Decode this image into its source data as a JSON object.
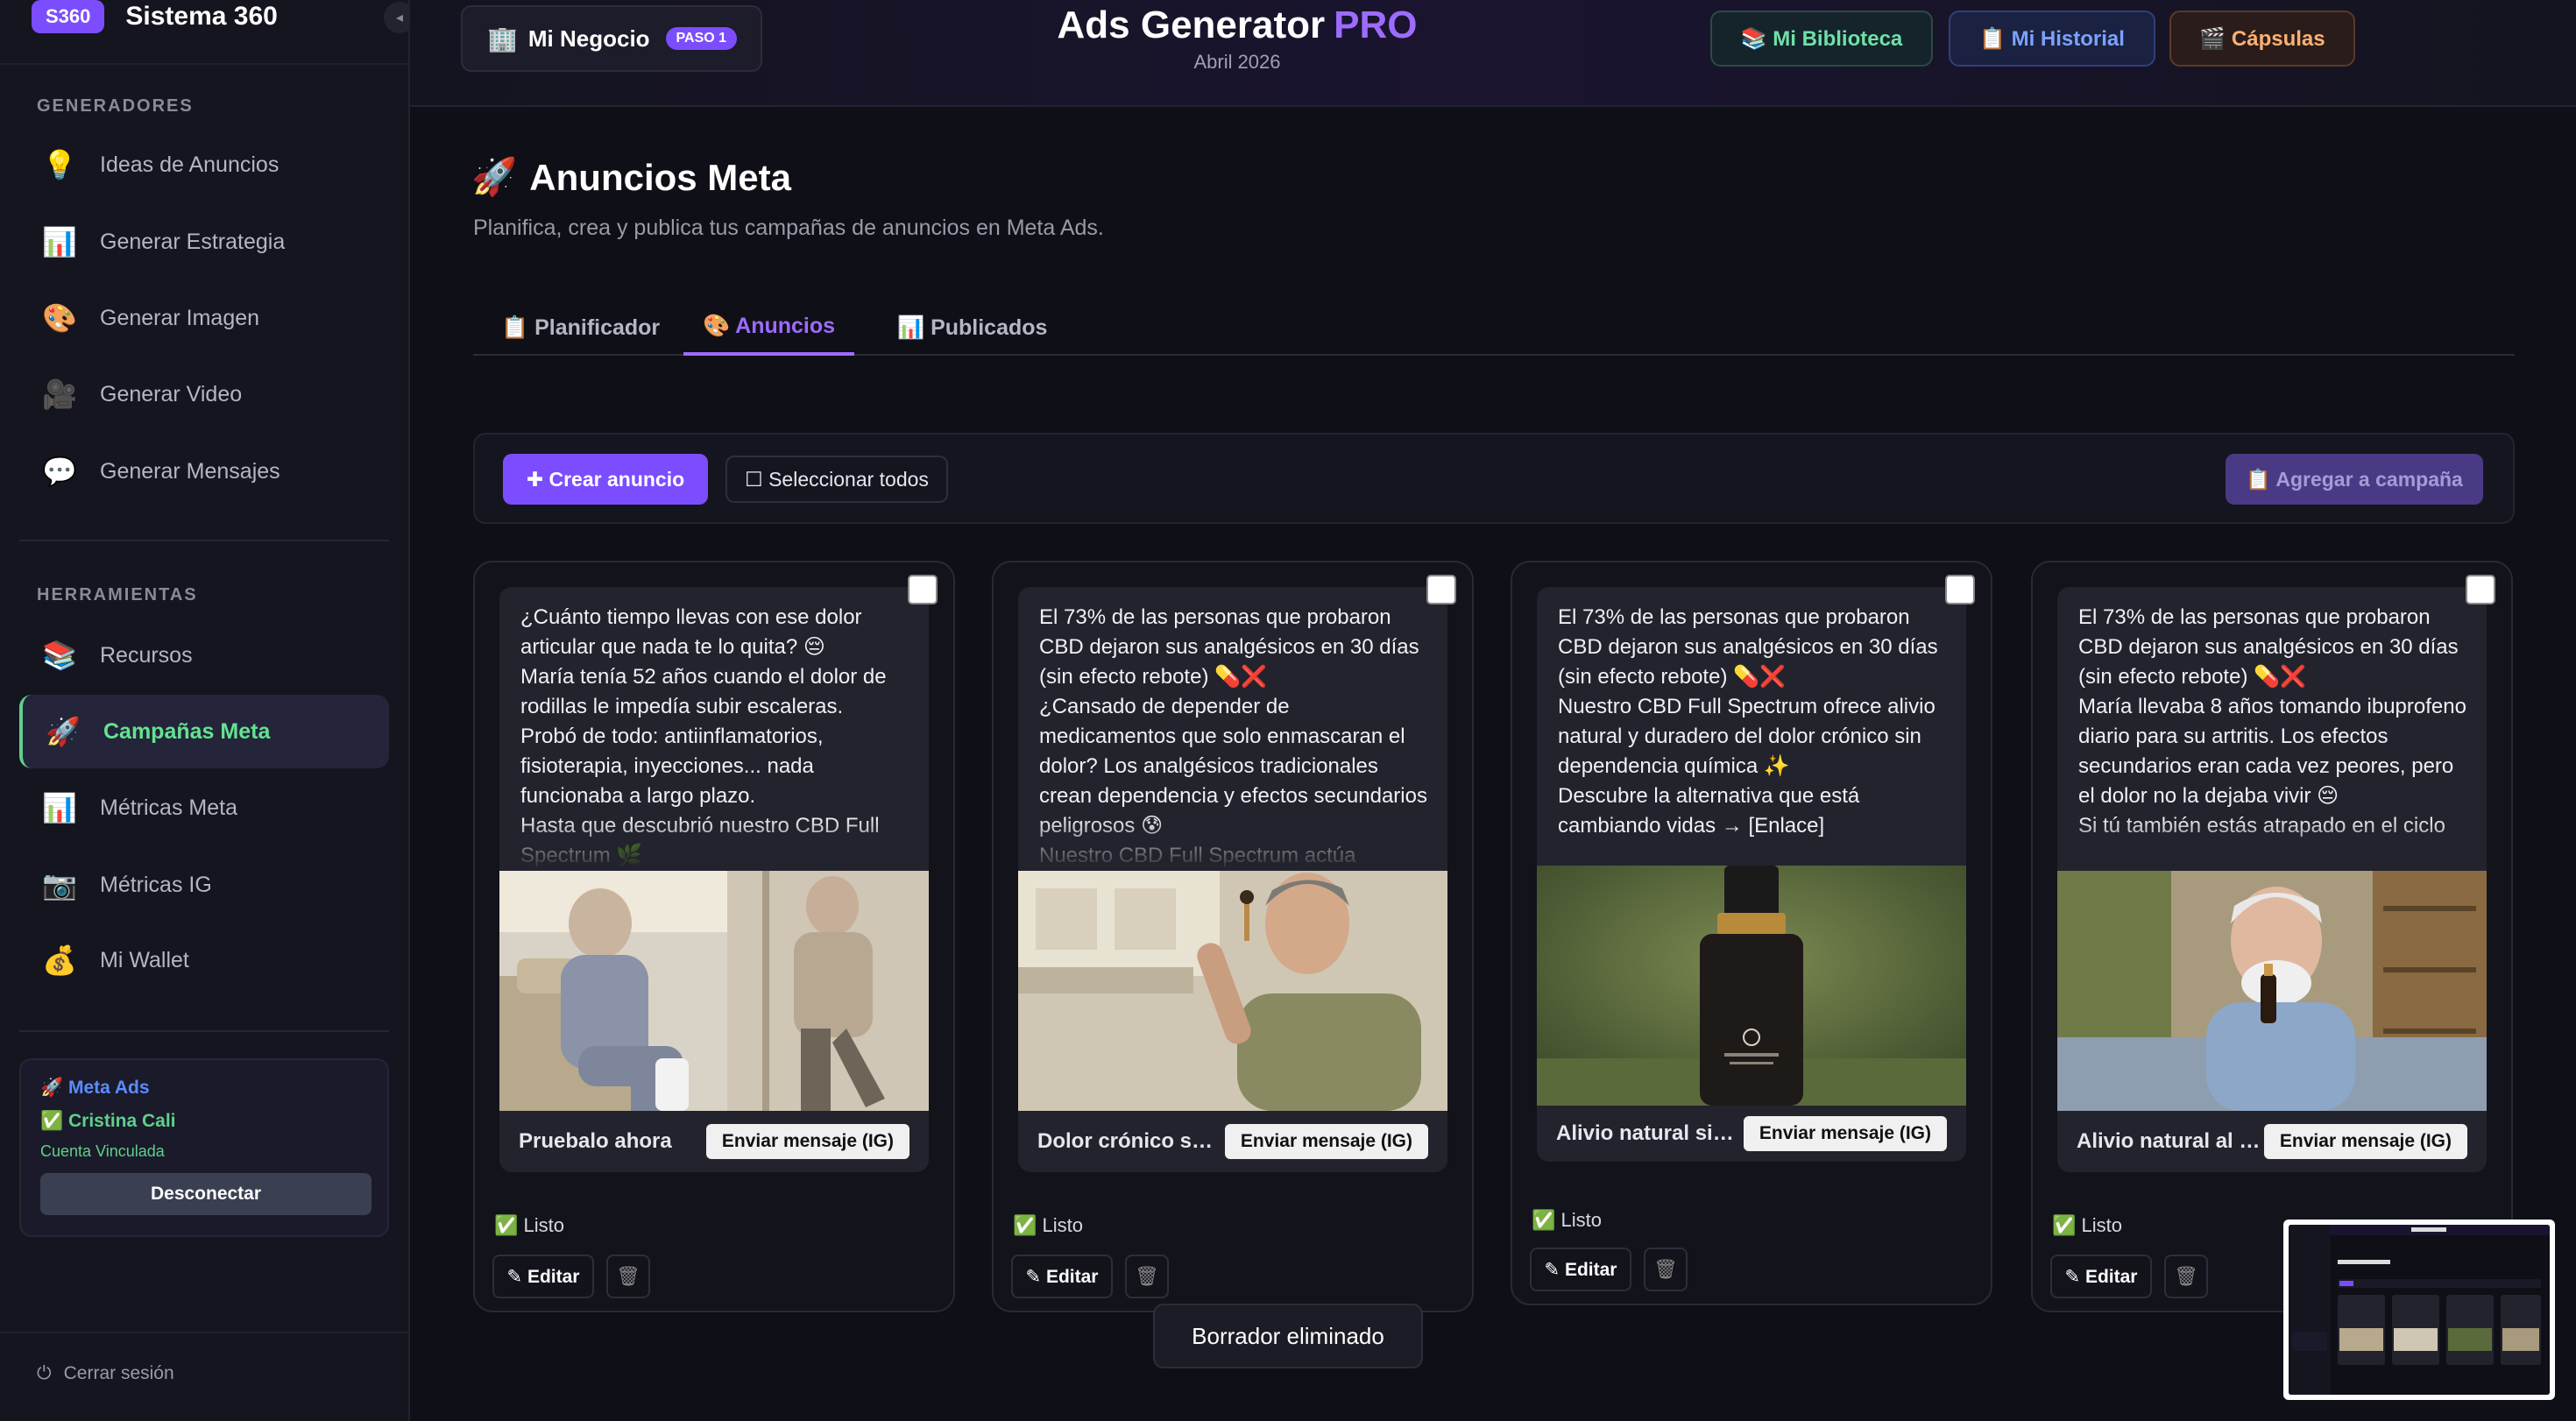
{
  "sidebar": {
    "badge": "S360",
    "brand": "Sistema 360",
    "collapse_icon": "◂",
    "sections": [
      {
        "title": "GENERADORES"
      },
      {
        "title": "HERRAMIENTAS"
      }
    ],
    "generadores": [
      {
        "icon": "💡",
        "label": "Ideas de Anuncios"
      },
      {
        "icon": "📊",
        "label": "Generar Estrategia"
      },
      {
        "icon": "🎨",
        "label": "Generar Imagen"
      },
      {
        "icon": "🎥",
        "label": "Generar Video"
      },
      {
        "icon": "💬",
        "label": "Generar Mensajes"
      }
    ],
    "herramientas": [
      {
        "icon": "📚",
        "label": "Recursos"
      },
      {
        "icon": "🚀",
        "label": "Campañas Meta"
      },
      {
        "icon": "📊",
        "label": "Métricas Meta"
      },
      {
        "icon": "📷",
        "label": "Métricas IG"
      },
      {
        "icon": "💰",
        "label": "Mi Wallet"
      }
    ],
    "meta": {
      "title": "🚀 Meta Ads",
      "user": "✅ Cristina Cali",
      "status": "Cuenta Vinculada",
      "disconnect": "Desconectar"
    },
    "logout_icon": "⏻",
    "logout": "Cerrar sesión"
  },
  "topbar": {
    "biz_icon": "🏢",
    "biz_name": "Mi Negocio",
    "paso": "PASO 1",
    "title": "Ads Generator",
    "title_pro": "PRO",
    "subtitle": "Abril 2026",
    "buttons": {
      "biblioteca": "📚 Mi Biblioteca",
      "historial": "📋 Mi Historial",
      "capsulas": "🎬 Cápsulas"
    }
  },
  "main": {
    "title_icon": "🚀",
    "title": "Anuncios Meta",
    "subtitle": "Planifica, crea y publica tus campañas de anuncios en Meta Ads.",
    "tabs": [
      {
        "label": "📋 Planificador"
      },
      {
        "label": "🎨 Anuncios"
      },
      {
        "label": "📊 Publicados"
      }
    ],
    "toolbar": {
      "create": "✚ Crear anuncio",
      "select_all": "☐ Seleccionar todos",
      "add_campaign": "📋 Agregar a campaña"
    }
  },
  "cards": [
    {
      "text": "¿Cuánto tiempo llevas con ese dolor articular que nada te lo quita? 😔\nMaría tenía 52 años cuando el dolor de rodillas le impedía subir escaleras.\nProbó de todo: antiinflamatorios, fisioterapia, inyecciones... nada funcionaba a largo plazo.\nHasta que descubrió nuestro CBD Full Spectrum 🌿",
      "cta_title": "Pruebalo ahora",
      "cta_button": "Enviar mensaje (IG)",
      "status": "✅ Listo",
      "edit": "✎ Editar",
      "delete_icon": "🗑"
    },
    {
      "text": "El 73% de las personas que probaron CBD dejaron sus analgésicos en 30 días (sin efecto rebote) 💊❌\n¿Cansado de depender de medicamentos que solo enmascaran el dolor? Los analgésicos tradicionales crean dependencia y efectos secundarios peligrosos 😰\nNuestro CBD Full Spectrum actúa",
      "cta_title": "Dolor crónico sobre el cuerpo",
      "cta_button": "Enviar mensaje (IG)",
      "status": "✅ Listo",
      "edit": "✎ Editar",
      "delete_icon": "🗑"
    },
    {
      "text": "El 73% de las personas que probaron CBD dejaron sus analgésicos en 30 días (sin efecto rebote) 💊❌\nNuestro CBD Full Spectrum ofrece alivio natural y duradero del dolor crónico sin dependencia química ✨\nDescubre la alternativa que está cambiando vidas → [Enlace]",
      "cta_title": "Alivio natural sin dependencia",
      "cta_button": "Enviar mensaje (IG)",
      "status": "✅ Listo",
      "edit": "✎ Editar",
      "delete_icon": "🗑"
    },
    {
      "text": "El 73% de las personas que probaron CBD dejaron sus analgésicos en 30 días (sin efecto rebote) 💊❌\nMaría llevaba 8 años tomando ibuprofeno diario para su artritis. Los efectos secundarios eran cada vez peores, pero el dolor no la dejaba vivir 😔\nSi tú también estás atrapado en el ciclo",
      "cta_title": "Alivio natural al instante",
      "cta_button": "Enviar mensaje (IG)",
      "status": "✅ Listo",
      "edit": "✎ Editar",
      "delete_icon": "🗑"
    }
  ],
  "toast": "Borrador eliminado"
}
